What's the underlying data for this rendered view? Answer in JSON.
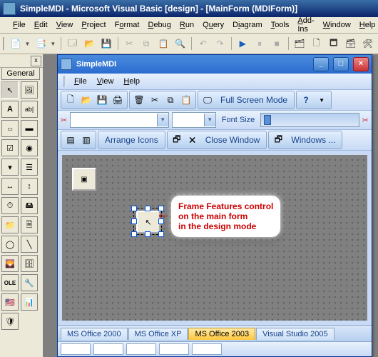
{
  "main": {
    "title": "SimpleMDI - Microsoft Visual Basic [design] - [MainForm (MDIForm)]",
    "menu": {
      "file": "File",
      "edit": "Edit",
      "view": "View",
      "project": "Project",
      "format": "Format",
      "debug": "Debug",
      "run": "Run",
      "query": "Query",
      "diagram": "Diagram",
      "tools": "Tools",
      "addins": "Add-Ins",
      "window": "Window",
      "help": "Help"
    }
  },
  "toolbox": {
    "close": "x",
    "general_tab": "General"
  },
  "child": {
    "title": "SimpleMDI",
    "menu": {
      "file": "File",
      "view": "View",
      "help": "Help"
    },
    "tb": {
      "fullscreen": "Full Screen Mode",
      "font_size": "Font Size",
      "arrange": "Arrange Icons",
      "close_win": "Close Window",
      "windows": "Windows ..."
    },
    "tabs": [
      "MS Office 2000",
      "MS Office XP",
      "MS Office 2003",
      "Visual Studio 2005"
    ],
    "selected_tab": 2
  },
  "callout": {
    "l1": "Frame Features control",
    "l2": "on the main form",
    "l3": "in the design mode"
  }
}
